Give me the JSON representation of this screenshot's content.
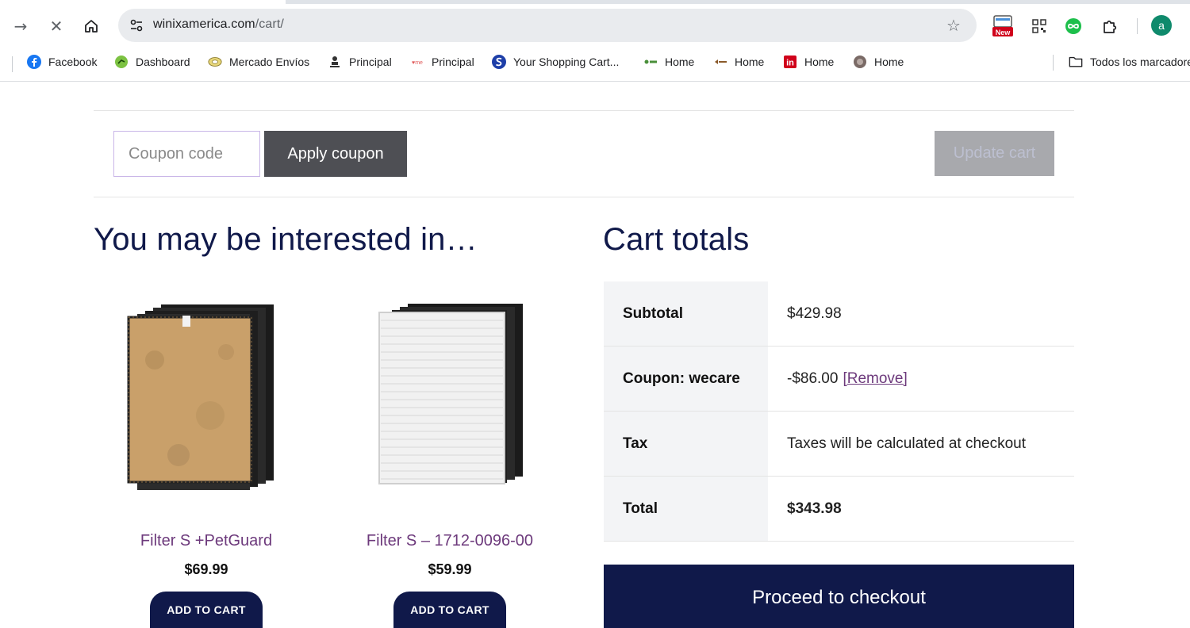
{
  "browser": {
    "url_host": "winixamerica.com",
    "url_path": "/cart/",
    "profile_initial": "a",
    "bookmarks": [
      {
        "label": "Facebook",
        "icon": "facebook-icon",
        "color": "#1877f2"
      },
      {
        "label": "Dashboard",
        "icon": "dashboard-icon",
        "color": "#7cc242"
      },
      {
        "label": "Mercado Envíos",
        "icon": "mercado-envios-icon",
        "color": "#c9b04b"
      },
      {
        "label": "Principal",
        "icon": "principal-icon",
        "color": "#333333"
      },
      {
        "label": "Principal",
        "icon": "principal-red-icon",
        "color": "#e05a5a"
      },
      {
        "label": "Your Shopping Cart...",
        "icon": "shopping-cart-s-icon",
        "color": "#1e3fa8"
      },
      {
        "label": "Home",
        "icon": "home-green-icon",
        "color": "#4a8f3a"
      },
      {
        "label": "Home",
        "icon": "home-arrow-icon",
        "color": "#8a5a2a"
      },
      {
        "label": "Home",
        "icon": "home-in-icon",
        "color": "#d0021b"
      },
      {
        "label": "Home",
        "icon": "home-round-icon",
        "color": "#7a6a66"
      }
    ],
    "all_bookmarks_label": "Todos los marcadores"
  },
  "cart_actions": {
    "coupon_placeholder": "Coupon code",
    "apply_label": "Apply coupon",
    "update_label": "Update cart"
  },
  "cross_sells": {
    "title": "You may be interested in…",
    "products": [
      {
        "name": "Filter S +PetGuard",
        "price": "$69.99",
        "button": "ADD TO CART"
      },
      {
        "name": "Filter S – 1712-0096-00",
        "price": "$59.99",
        "button": "ADD TO CART"
      }
    ]
  },
  "totals": {
    "title": "Cart totals",
    "rows": [
      {
        "label": "Subtotal",
        "value": "$429.98"
      },
      {
        "label": "Coupon: wecare",
        "value": "-$86.00",
        "link": "[Remove]"
      },
      {
        "label": "Tax",
        "value": "Taxes will be calculated at checkout"
      },
      {
        "label": "Total",
        "value": "$343.98"
      }
    ],
    "checkout_label": "Proceed to checkout"
  },
  "colors": {
    "brand_navy": "#10194a",
    "link_purple": "#6d3a7c",
    "apply_button": "#4e4f54",
    "update_button_disabled": "#a8a9ad"
  }
}
